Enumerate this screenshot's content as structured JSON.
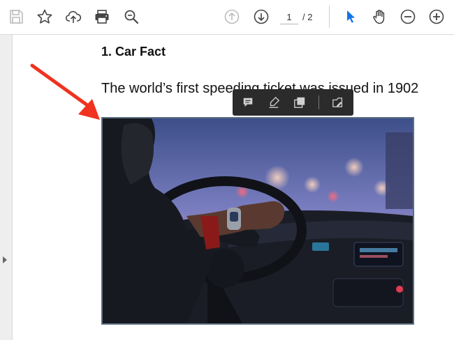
{
  "toolbar": {
    "icons": [
      "save-icon",
      "bookmark-star-icon",
      "upload-cloud-icon",
      "print-icon",
      "zoom-search-icon",
      "page-up-icon",
      "page-down-icon",
      "select-cursor-icon",
      "hand-tool-icon",
      "zoom-out-icon",
      "zoom-in-icon"
    ],
    "current_page": "1",
    "page_total": "/ 2",
    "accent_color": "#1473e6"
  },
  "document": {
    "heading": "1. Car Fact",
    "body_text": "The world’s first speeding ticket was issued in 1902"
  },
  "context_toolbar": {
    "icons": [
      "comment-icon",
      "highlight-pen-icon",
      "copy-image-icon",
      "edit-image-icon"
    ]
  },
  "annotation": {
    "arrow_color": "#f0321e"
  }
}
